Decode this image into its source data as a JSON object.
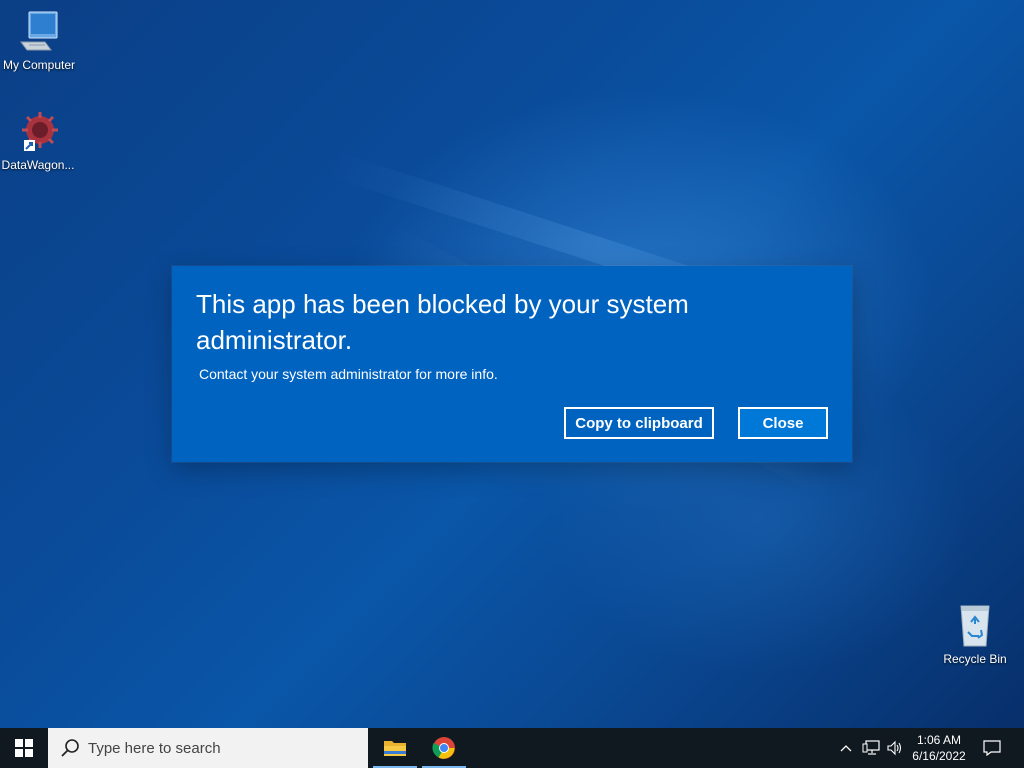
{
  "desktop": {
    "icons": [
      {
        "label": "My Computer",
        "icon": "computer-icon"
      },
      {
        "label": "DataWagon...",
        "icon": "datawagon-app-icon"
      },
      {
        "label": "Recycle Bin",
        "icon": "recycle-bin-icon"
      }
    ]
  },
  "dialog": {
    "title": "This app has been blocked by your system administrator.",
    "message": "Contact your system administrator for more info.",
    "copy_label": "Copy to clipboard",
    "close_label": "Close",
    "accent": "#0063c0"
  },
  "taskbar": {
    "start_icon": "windows-logo-icon",
    "search_placeholder": "Type here to search",
    "apps": [
      {
        "name": "File Explorer",
        "icon": "folder-icon"
      },
      {
        "name": "Google Chrome",
        "icon": "chrome-icon"
      }
    ],
    "tray": {
      "time": "1:06 AM",
      "date": "6/16/2022",
      "icons": [
        "chevron-up-icon",
        "network-icon",
        "volume-icon",
        "notification-icon"
      ]
    }
  }
}
